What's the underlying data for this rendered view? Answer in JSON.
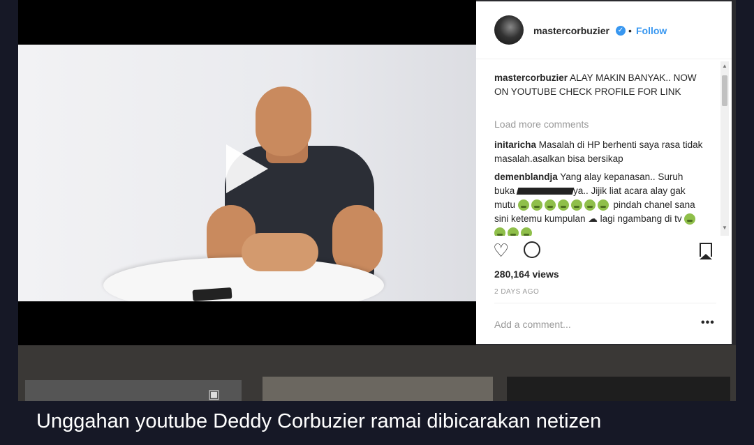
{
  "post": {
    "username": "mastercorbuzier",
    "follow_label": "Follow",
    "dot_separator": "•",
    "verified_icon": "verified-badge-icon",
    "caption_text": "ALAY MAKIN BANYAK.. NOW ON YOUTUBE CHECK PROFILE FOR LINK",
    "load_more": "Load more comments",
    "comments": [
      {
        "user": "initaricha",
        "text": "Masalah di HP berhenti saya rasa tidak masalah.asalkan bisa bersikap"
      },
      {
        "user": "demenblandja",
        "text_a": "Yang alay kepanasan.. Suruh buka",
        "text_b": "ya.. Jijik liat acara alay gak mutu",
        "text_c": "pindah chanel sana sini ketemu kumpulan",
        "text_d": "lagi ngambang di tv"
      }
    ],
    "views": "280,164 views",
    "time_ago": "2 DAYS AGO",
    "add_comment_placeholder": "Add a comment...",
    "more_options": "•••"
  },
  "caption_bar": {
    "text": "Unggahan youtube Deddy Corbuzier ramai dibicarakan netizen"
  },
  "colors": {
    "accent": "#3897f0",
    "page_bg": "#161826"
  },
  "icons": [
    "play-icon",
    "heart-icon",
    "comment-icon",
    "bookmark-icon",
    "camera-icon"
  ]
}
